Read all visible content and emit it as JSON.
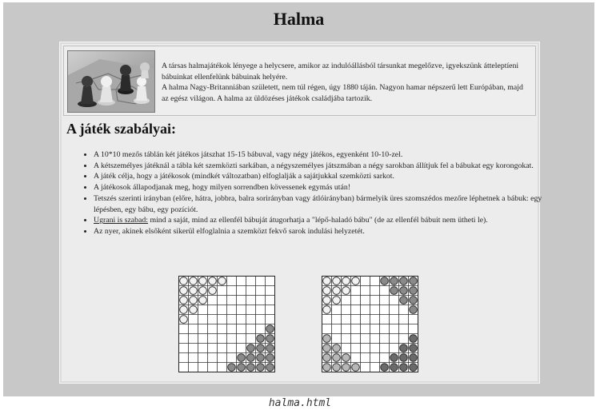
{
  "title": "Halma",
  "intro": {
    "photo_name": "halma-pieces-photo",
    "paragraphs": [
      "A társas halmajátékok lényege a helycsere, amikor az indulóállásból társunkat megelőzve, igyekszünk átteleptíeni bábuinkat ellenfelünk bábuinak helyére.",
      "A halma Nagy-Britanniában született, nem túl régen, úgy 1880 táján. Nagyon hamar népszerű lett Európában, majd az egész világon. A halma az üldözéses játékok családjába tartozik."
    ]
  },
  "rules": {
    "heading": "A játék szabályai:",
    "items": [
      {
        "text": "A 10*10 mezős táblán két játékos játszhat 15-15 bábuval, vagy négy játékos, egyenként 10-10-zel."
      },
      {
        "text": "A kétszemélyes játéknál a tábla két szemközti sarkában, a négyszemélyes játszmában a négy sarokban állítjuk fel a bábukat egy korongokat."
      },
      {
        "text": "A játék célja, hogy a játékosok (mindkét változatban) elfoglalják a sajátjukkal szemközti sarkot."
      },
      {
        "text": "A játékosok állapodjanak meg, hogy milyen sorrendben kövessenek egymás után!"
      },
      {
        "text": "Tetszés szerinti irányban (előre, hátra, jobbra, balra sorirányban vagy átlóirányban) bármelyik üres szomszédos mezőre léphetnek a bábuk: egy lépésben, egy bábu, egy pozíciót."
      },
      {
        "link": "Ugrani is szabad:",
        "text": " mind a saját, mind az ellenfél bábuját átugorhatja a \"lépő-haladó bábu\" (de az ellenfél bábuit nem ütheti le)."
      },
      {
        "text": "Az nyer, akinek elsőként sikerül elfoglalnia a szemközt fekvő sarok indulási helyzetét."
      }
    ]
  },
  "boards": [
    {
      "name": "two-player-setup",
      "size": 10,
      "pieces": [
        {
          "c": "white",
          "cells": [
            [
              0,
              0
            ],
            [
              0,
              1
            ],
            [
              0,
              2
            ],
            [
              0,
              3
            ],
            [
              0,
              4
            ],
            [
              1,
              0
            ],
            [
              1,
              1
            ],
            [
              1,
              2
            ],
            [
              1,
              3
            ],
            [
              2,
              0
            ],
            [
              2,
              1
            ],
            [
              2,
              2
            ],
            [
              3,
              0
            ],
            [
              3,
              1
            ],
            [
              4,
              0
            ]
          ]
        },
        {
          "c": "gray",
          "cells": [
            [
              5,
              9
            ],
            [
              6,
              8
            ],
            [
              6,
              9
            ],
            [
              7,
              7
            ],
            [
              7,
              8
            ],
            [
              7,
              9
            ],
            [
              8,
              6
            ],
            [
              8,
              7
            ],
            [
              8,
              8
            ],
            [
              8,
              9
            ],
            [
              9,
              5
            ],
            [
              9,
              6
            ],
            [
              9,
              7
            ],
            [
              9,
              8
            ],
            [
              9,
              9
            ]
          ]
        }
      ]
    },
    {
      "name": "four-player-setup",
      "size": 10,
      "pieces": [
        {
          "c": "white",
          "cells": [
            [
              0,
              0
            ],
            [
              0,
              1
            ],
            [
              0,
              2
            ],
            [
              0,
              3
            ],
            [
              1,
              0
            ],
            [
              1,
              1
            ],
            [
              1,
              2
            ],
            [
              2,
              0
            ],
            [
              2,
              1
            ],
            [
              3,
              0
            ]
          ]
        },
        {
          "c": "gray",
          "cells": [
            [
              0,
              6
            ],
            [
              0,
              7
            ],
            [
              0,
              8
            ],
            [
              0,
              9
            ],
            [
              1,
              7
            ],
            [
              1,
              8
            ],
            [
              1,
              9
            ],
            [
              2,
              8
            ],
            [
              2,
              9
            ],
            [
              3,
              9
            ]
          ]
        },
        {
          "c": "lightgray",
          "cells": [
            [
              6,
              0
            ],
            [
              7,
              0
            ],
            [
              7,
              1
            ],
            [
              8,
              0
            ],
            [
              8,
              1
            ],
            [
              8,
              2
            ],
            [
              9,
              0
            ],
            [
              9,
              1
            ],
            [
              9,
              2
            ],
            [
              9,
              3
            ]
          ]
        },
        {
          "c": "dark",
          "cells": [
            [
              6,
              9
            ],
            [
              7,
              8
            ],
            [
              7,
              9
            ],
            [
              8,
              7
            ],
            [
              8,
              8
            ],
            [
              8,
              9
            ],
            [
              9,
              6
            ],
            [
              9,
              7
            ],
            [
              9,
              8
            ],
            [
              9,
              9
            ]
          ]
        }
      ]
    }
  ],
  "piece_colors": {
    "white": "#f2f2f2",
    "gray": "#8a8a8a",
    "lightgray": "#b8b8b8",
    "dark": "#6a6a6a"
  },
  "caption": "halma.html"
}
